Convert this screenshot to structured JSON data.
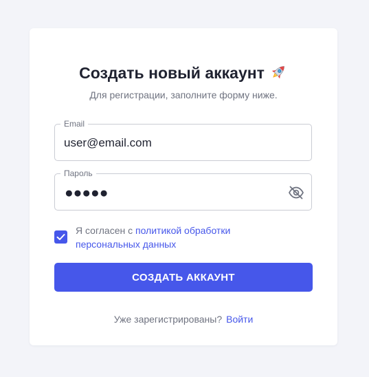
{
  "header": {
    "title": "Создать новый аккаунт",
    "title_emoji_icon": "rocket-icon",
    "subtitle": "Для регистрации, заполните форму ниже."
  },
  "form": {
    "email": {
      "label": "Email",
      "value": "user@email.com"
    },
    "password": {
      "label": "Пароль",
      "masked_value": "●●●●●",
      "toggle_icon": "eye-off-icon"
    },
    "agreement": {
      "checked": true,
      "text_before": "Я согласен с ",
      "link_text": "политикой обработки персональных данных"
    },
    "submit_label": "СОЗДАТЬ АККАУНТ"
  },
  "footer": {
    "question": "Уже зарегистрированы?",
    "login_link": "Войти"
  },
  "colors": {
    "background": "#f3f4f9",
    "card": "#ffffff",
    "accent": "#4657ea",
    "text_primary": "#1f2230",
    "text_secondary": "#6f7380",
    "border": "#c9cbd3"
  }
}
